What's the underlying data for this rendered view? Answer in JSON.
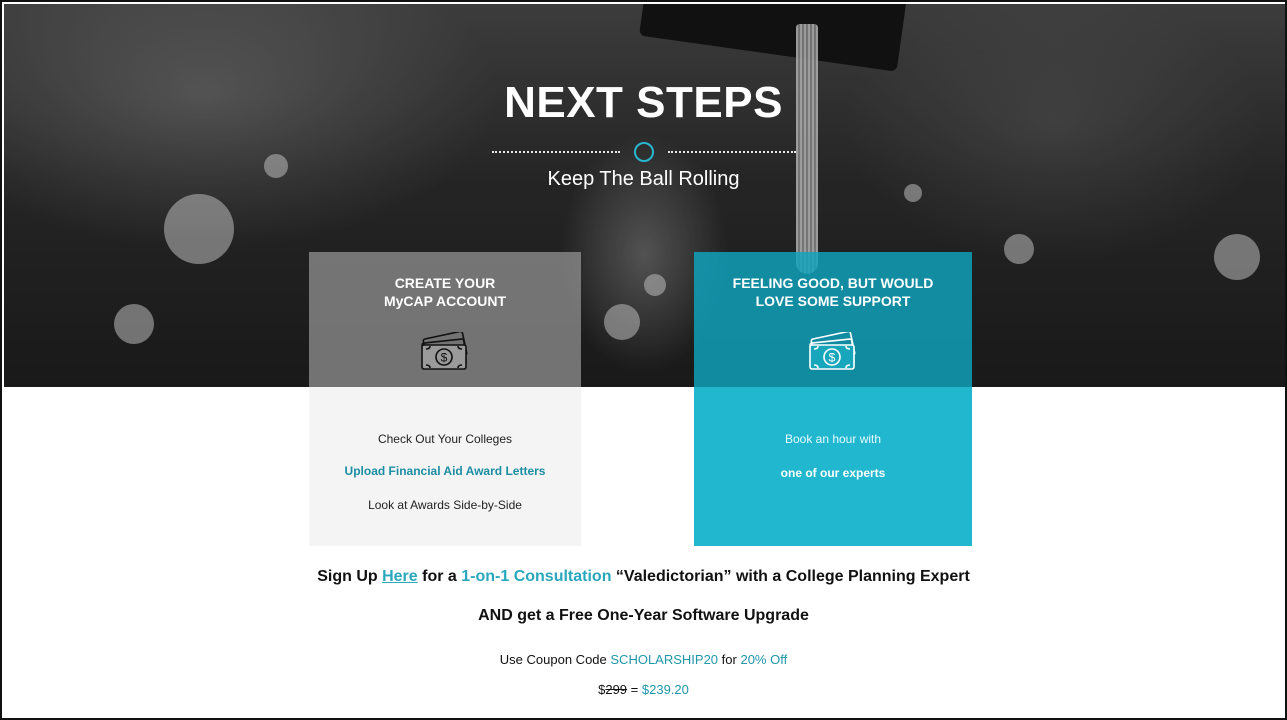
{
  "hero": {
    "title": "NEXT STEPS",
    "subtitle": "Keep The Ball Rolling"
  },
  "cards": [
    {
      "heading_line1": "CREATE YOUR",
      "heading_line2": "MyCAP ACCOUNT",
      "icon": "money-bill-icon",
      "lines": [
        "Check Out Your Colleges",
        "Upload Financial Aid Award Letters",
        "Look at Awards Side-by-Side"
      ]
    },
    {
      "heading_line1": "FEELING GOOD, BUT WOULD",
      "heading_line2": "LOVE SOME SUPPORT",
      "icon": "money-bill-icon",
      "lines": [
        "Book an hour with",
        "one of our experts"
      ]
    }
  ],
  "cta": {
    "prefix": "Sign Up",
    "link_text": "Here",
    "middle": "for a",
    "highlight": "1-on-1 Consultation",
    "suffix": "“Valedictorian” with a College Planning Expert",
    "line2": "AND get a Free One-Year Software Upgrade"
  },
  "coupon": {
    "prefix": "Use Coupon Code",
    "code": "SCHOLARSHIP20",
    "middle": "for",
    "discount": "20% Off"
  },
  "price": {
    "currency": "$",
    "old": "299",
    "equals": "=",
    "new": "$239.20"
  },
  "colors": {
    "accent": "#29a8bd",
    "card_right": "#21b7cf"
  }
}
